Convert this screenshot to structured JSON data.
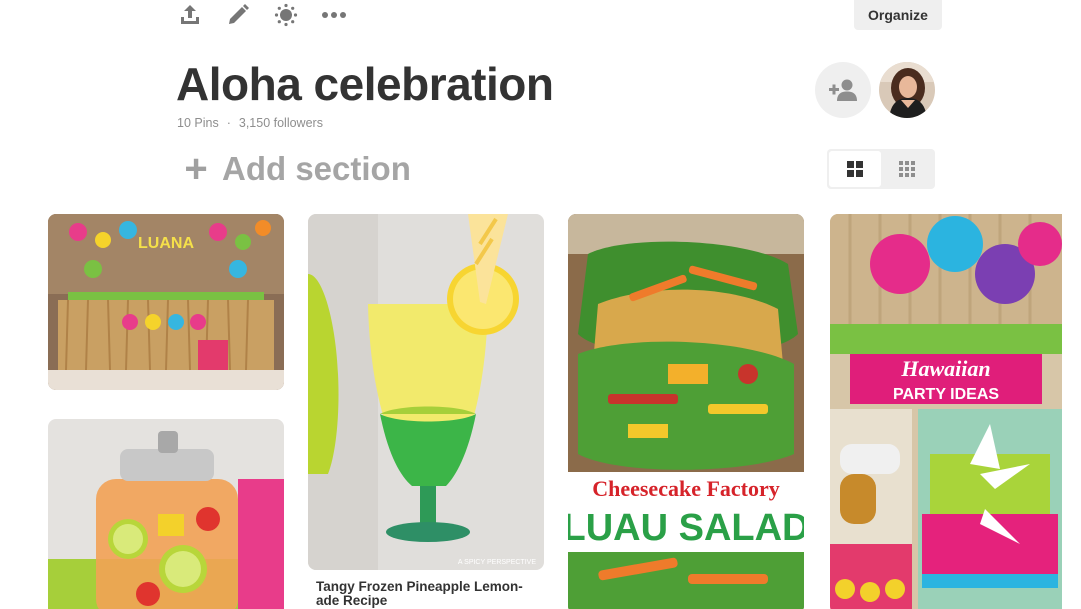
{
  "toolbar": {
    "icons": [
      "share-icon",
      "edit-icon",
      "sparkle-icon",
      "more-icon"
    ]
  },
  "organize_label": "Organize",
  "board": {
    "title": "Aloha celebration",
    "pins_count": "10 Pins",
    "separator": "·",
    "followers": "3,150 followers"
  },
  "add_section_label": "Add section",
  "pins": [
    {
      "name": "luana-party-table",
      "text": "LUANA"
    },
    {
      "name": "pineapple-lemonade",
      "watermark": "A SPICY PERSPECTIVE",
      "caption": "Tangy Frozen Pineapple Lemon-ade Recipe"
    },
    {
      "name": "cheesecake-luau-salad",
      "overlay_line1": "Cheesecake Factory",
      "overlay_line2": "LUAU SALAD"
    },
    {
      "name": "hawaiian-party-ideas",
      "overlay_line1": "Hawaiian",
      "overlay_line2": "PARTY IDEAS"
    },
    {
      "name": "fruit-sangria-jar"
    }
  ],
  "colors": {
    "title": "#333333",
    "muted": "#8e8e8e",
    "button_bg": "#efefef"
  }
}
